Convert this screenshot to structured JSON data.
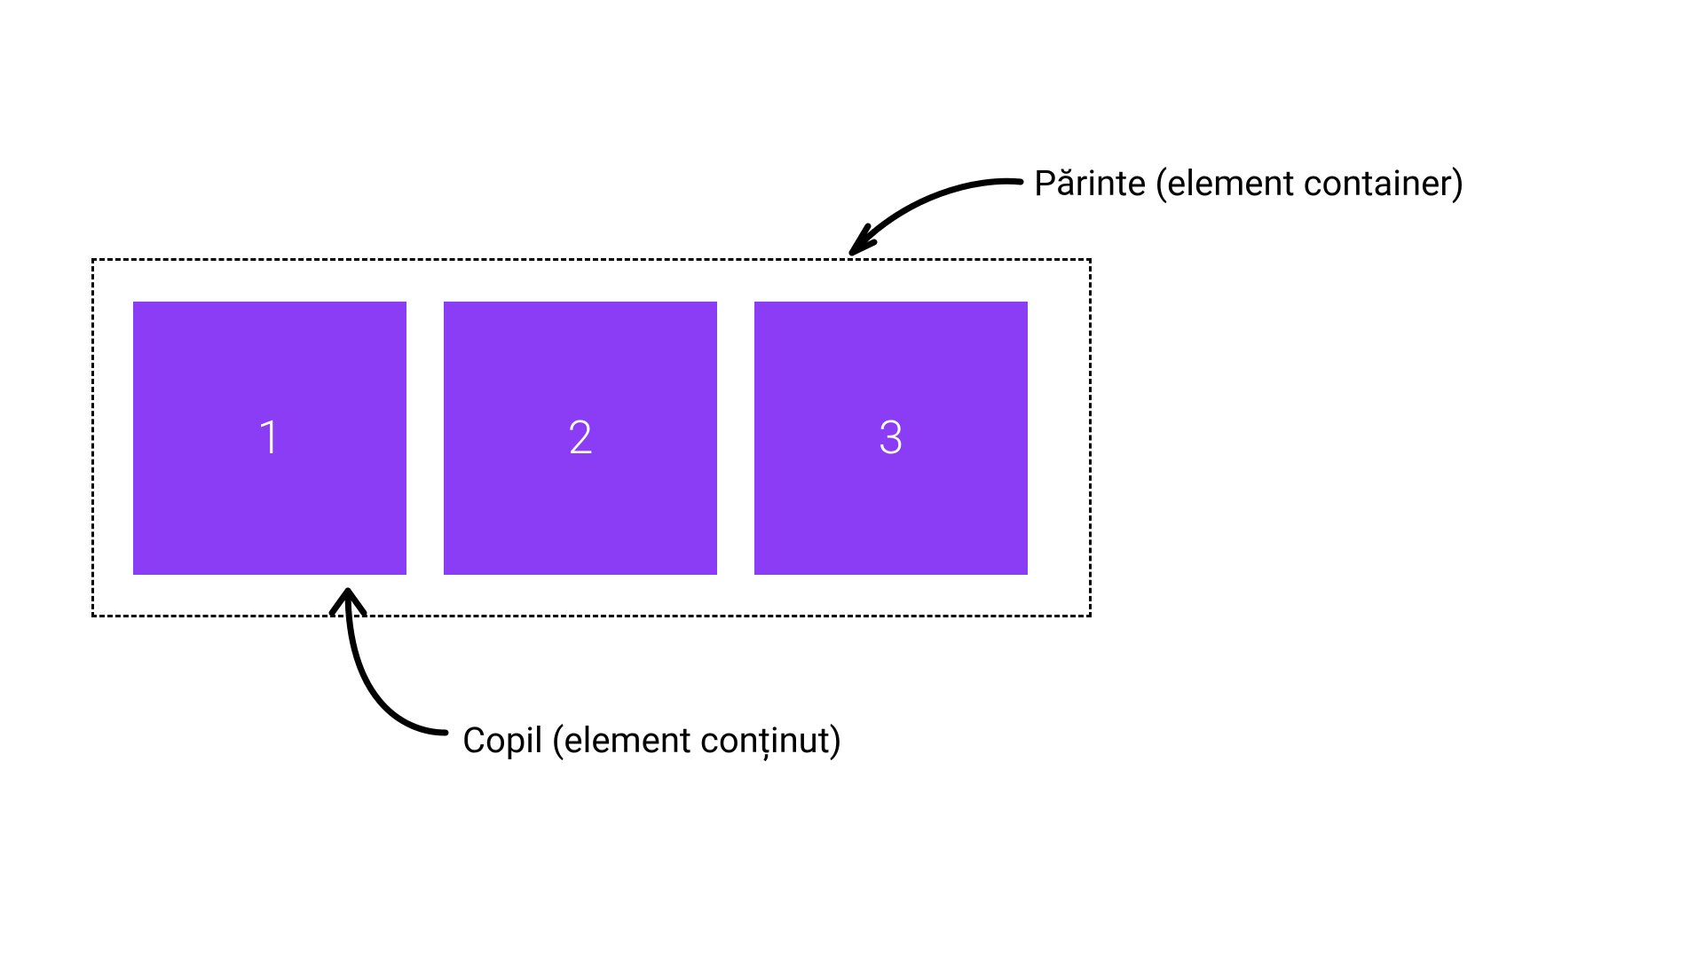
{
  "labels": {
    "parent": "Părinte (element container)",
    "child": "Copil (element conținut)"
  },
  "boxes": [
    {
      "number": "1"
    },
    {
      "number": "2"
    },
    {
      "number": "3"
    }
  ],
  "colors": {
    "box_fill": "#8b3df5",
    "box_text": "#ffffff",
    "border": "#000000"
  }
}
